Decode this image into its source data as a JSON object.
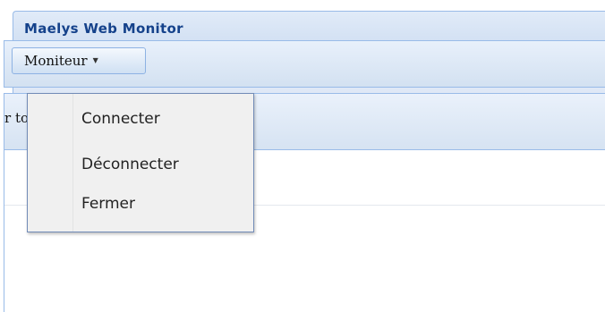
{
  "window": {
    "title": "Maelys Web Monitor"
  },
  "toolbar": {
    "menu_label": "Moniteur",
    "menu_arrow": "▼"
  },
  "panel": {
    "header_text": "r tout"
  },
  "dropdown": {
    "items": [
      {
        "label": "Connecter"
      },
      {
        "label": "Déconnecter"
      },
      {
        "label": "Fermer"
      }
    ]
  },
  "colors": {
    "title_text": "#15428b",
    "panel_border": "#99bbe8",
    "panel_background": "#dfe8f6",
    "menu_background": "#f0f0f0"
  }
}
